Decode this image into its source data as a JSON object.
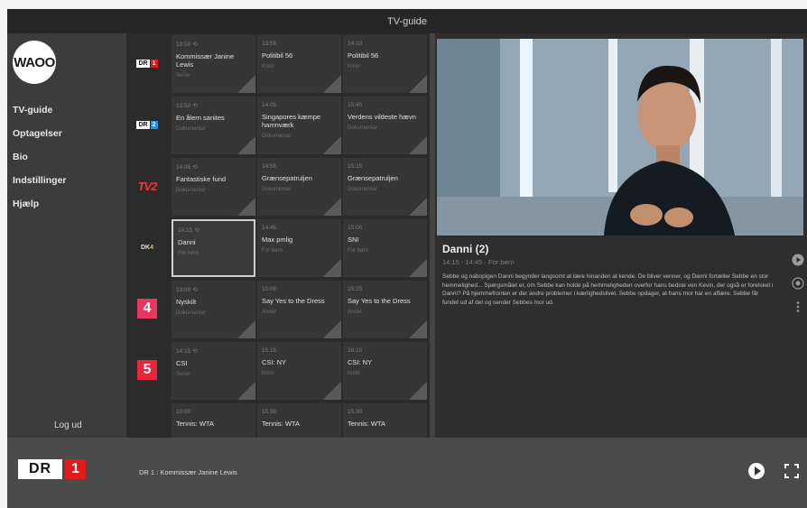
{
  "window": {
    "title": "TV-guide"
  },
  "sidebar": {
    "logo": "WAOO",
    "items": [
      {
        "label": "TV-guide"
      },
      {
        "label": "Optagelser"
      },
      {
        "label": "Bio"
      },
      {
        "label": "Indstillinger"
      },
      {
        "label": "Hjælp"
      }
    ],
    "logout": "Log ud"
  },
  "guide": {
    "rows": [
      {
        "channel": {
          "kind": "dr",
          "text": "DR",
          "num": "1",
          "color": "#e01b1b",
          "icon": "dr1-logo"
        },
        "programs": [
          {
            "time": "13:50 ⟲",
            "title": "Kommissær Janine Lewis",
            "genre": "Serier"
          },
          {
            "time": "13:55",
            "title": "Politibil 56",
            "genre": "Krimi"
          },
          {
            "time": "14:10",
            "title": "Politibil 56",
            "genre": "Krimi"
          }
        ]
      },
      {
        "channel": {
          "kind": "dr",
          "text": "DR",
          "num": "2",
          "color": "#2a8fd8",
          "icon": "dr2-logo"
        },
        "programs": [
          {
            "time": "13:50 ⟲",
            "title": "En ålern sanites",
            "genre": "Dokumentar"
          },
          {
            "time": "14:05",
            "title": "Singapores kæmpe hamnværk",
            "genre": "Dokumentar"
          },
          {
            "time": "15:40",
            "title": "Verdens vildeste hævn",
            "genre": "Dokumentar"
          }
        ]
      },
      {
        "channel": {
          "kind": "tv2",
          "text": "TV2",
          "icon": "tv2-logo"
        },
        "programs": [
          {
            "time": "14:05 ⟲",
            "title": "Fantastiske fund",
            "genre": "Dokumentar"
          },
          {
            "time": "14:55",
            "title": "Grænsepatruljen",
            "genre": "Dokumentar"
          },
          {
            "time": "15:15",
            "title": "Grænsepatruljen",
            "genre": "Dokumentar"
          }
        ]
      },
      {
        "channel": {
          "kind": "dk",
          "text": "DK",
          "accent": "4",
          "icon": "dk4-logo"
        },
        "programs": [
          {
            "time": "14:15 ⟲",
            "title": "Danni",
            "genre": "For børn",
            "selected": true
          },
          {
            "time": "14:45",
            "title": "Max pmlig",
            "genre": "For børn"
          },
          {
            "time": "15:00",
            "title": "SNI",
            "genre": "For børn"
          }
        ]
      },
      {
        "channel": {
          "kind": "sq",
          "text": "4",
          "color": "#e8365e",
          "icon": "channel4-logo"
        },
        "programs": [
          {
            "time": "13:00 ⟲",
            "title": "Nyskilt",
            "genre": "Dokumentar"
          },
          {
            "time": "15:00",
            "title": "Say Yes to the Dress",
            "genre": "Andet"
          },
          {
            "time": "15:25",
            "title": "Say Yes to the Dress",
            "genre": "Andet"
          }
        ]
      },
      {
        "channel": {
          "kind": "sq",
          "text": "5",
          "color": "#e8253b",
          "icon": "channel5-logo"
        },
        "programs": [
          {
            "time": "14:15 ⟲",
            "title": "CSI",
            "genre": "Serier"
          },
          {
            "time": "15:15",
            "title": "CSI: NY",
            "genre": "Krimi"
          },
          {
            "time": "16:10",
            "title": "CSI: NY",
            "genre": "Krimi"
          }
        ]
      },
      {
        "channel": {
          "kind": "partial",
          "text": "",
          "icon": "channel-logo"
        },
        "programs": [
          {
            "time": "13:00",
            "title": "Tennis: WTA",
            "genre": ""
          },
          {
            "time": "15:30",
            "title": "Tennis: WTA",
            "genre": ""
          },
          {
            "time": "15:30",
            "title": "Tennis: WTA",
            "genre": ""
          }
        ]
      }
    ]
  },
  "detail": {
    "title": "Danni (2)",
    "subtitle": "14:15 - 14:45 · For børn",
    "description": "Sebbe og nabopigen Danni begynder langsomt at lære hinanden at kende. De bliver venner, og Danni fortæller Sebbe en stor hemmelighed... Spørgsmålet er, om Sebbe kan holde på hemmeligheden overfor hans bedste ven Kevin, der også er forelsket i Danni? På hjemmefronten er der andre problemer i kærlighedslivet. Sebbe opdager, at hans mor har en affære. Sebbe får fundet ud af det og sender Sebbes mor ud."
  },
  "player": {
    "channel_text": "DR",
    "channel_num": "1",
    "now_playing": "DR 1 : Kommissær Janine Lewis"
  }
}
